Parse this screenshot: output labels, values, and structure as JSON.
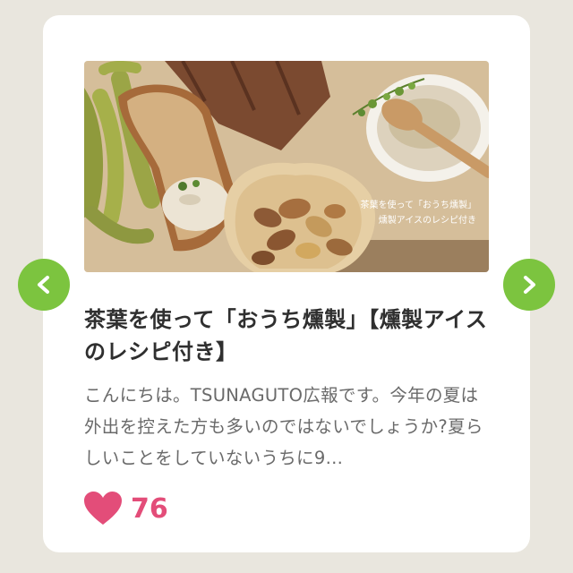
{
  "article": {
    "image_caption_line1": "茶葉を使って「おうち燻製」",
    "image_caption_line2": "燻製アイスのレシピ付き",
    "title": "茶葉を使って「おうち燻製」【燻製アイスのレシピ付き】",
    "excerpt": "こんにちは。TSUNAGUTO広報です。今年の夏は外出を控えた方も多いのではないでしょうか?夏らしいことをしていないうちに9…",
    "likes": "76"
  },
  "icons": {
    "prev": "chevron-left-icon",
    "next": "chevron-right-icon",
    "like": "heart-icon"
  },
  "colors": {
    "accent_green": "#7cc43f",
    "heart_pink": "#e34d79",
    "background": "#e9e6de"
  }
}
